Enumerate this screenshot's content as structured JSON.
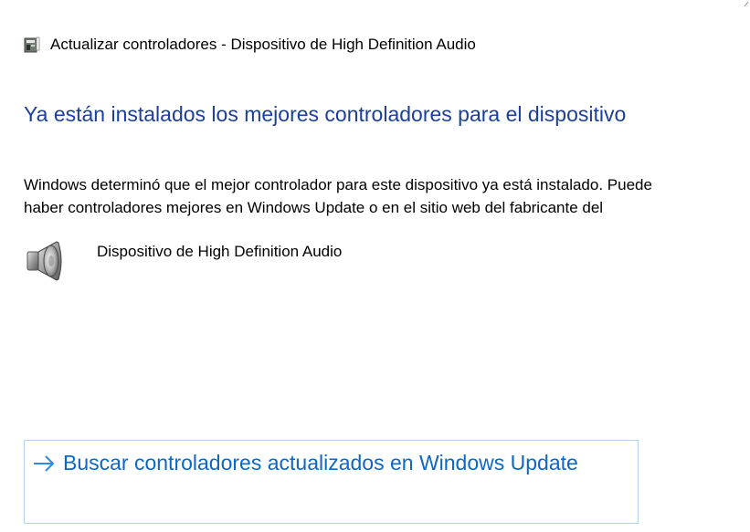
{
  "window": {
    "title": "Actualizar controladores - Dispositivo de High Definition Audio"
  },
  "heading": "Ya están instalados los mejores controladores para el dispositivo",
  "description": {
    "line1": "Windows determinó que el mejor controlador para este dispositivo ya está instalado. Puede",
    "line2": "haber controladores mejores en Windows Update o en el sitio web del fabricante del"
  },
  "device": {
    "name": "Dispositivo de High Definition Audio",
    "icon": "speaker-icon"
  },
  "action": {
    "label": "Buscar controladores actualizados en Windows Update",
    "icon": "arrow-right-icon"
  },
  "colors": {
    "heading": "#1b3f9a",
    "link": "#0b67c8",
    "action_border": "#b7d1ec",
    "arrow": "#2d8be0"
  }
}
